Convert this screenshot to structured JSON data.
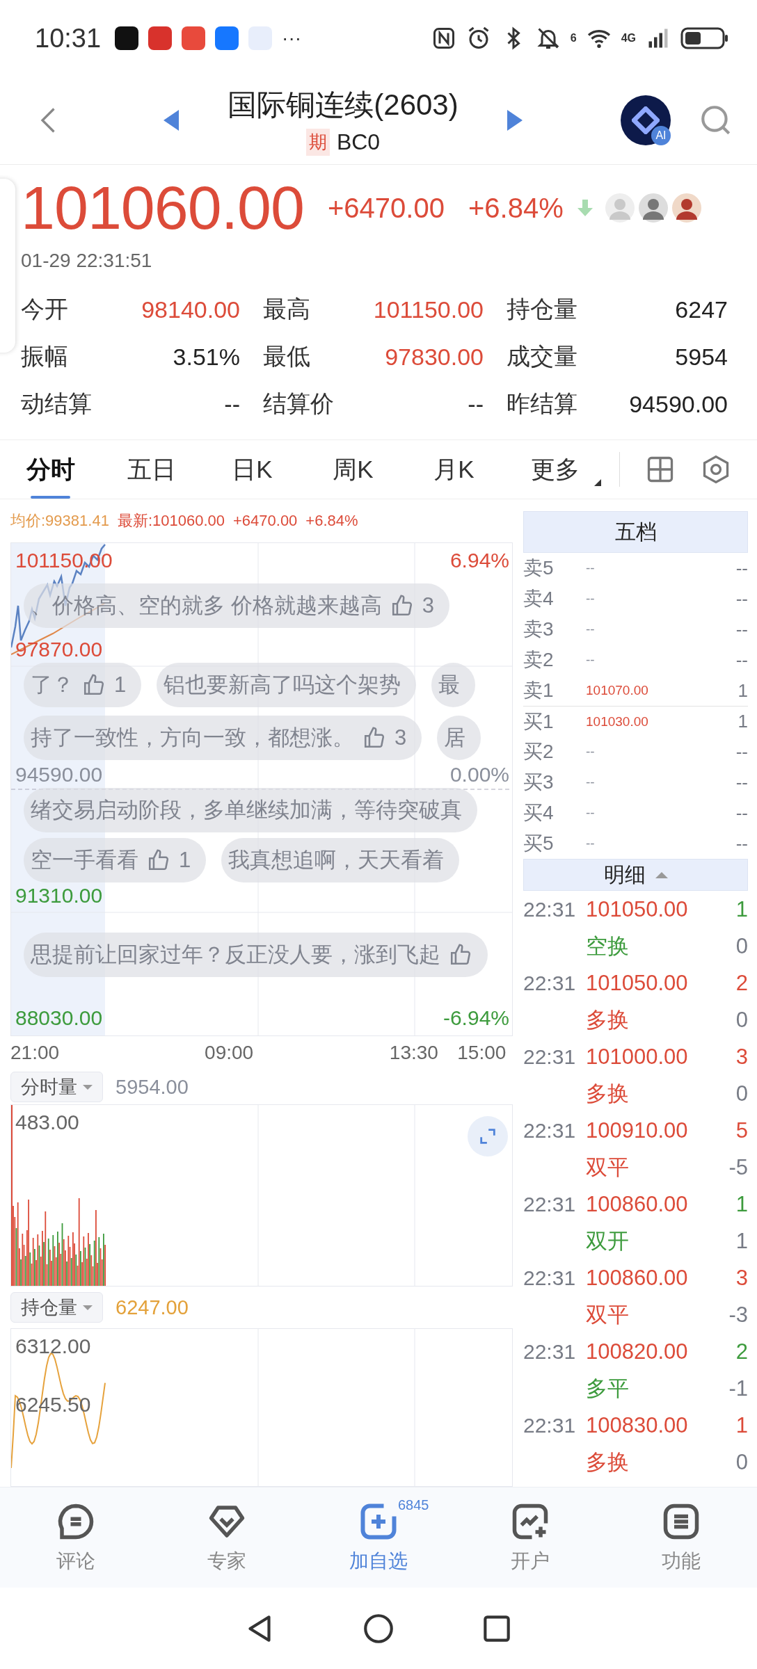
{
  "status_bar": {
    "time": "10:31",
    "more": "···",
    "wifi_badge": "6",
    "network": "4G"
  },
  "header": {
    "title": "国际铜连续(2603)",
    "tag": "期",
    "code": "BC0",
    "ai_badge": "AI"
  },
  "quote": {
    "price": "101060.00",
    "change": "+6470.00",
    "change_pct": "+6.84%",
    "timestamp": "01-29 22:31:51"
  },
  "stats": [
    {
      "label": "今开",
      "value": "98140.00",
      "color": "#dc4b39"
    },
    {
      "label": "最高",
      "value": "101150.00",
      "color": "#dc4b39"
    },
    {
      "label": "持仓量",
      "value": "6247",
      "color": "#222222"
    },
    {
      "label": "振幅",
      "value": "3.51%",
      "color": "#222222"
    },
    {
      "label": "最低",
      "value": "97830.00",
      "color": "#dc4b39"
    },
    {
      "label": "成交量",
      "value": "5954",
      "color": "#222222"
    },
    {
      "label": "动结算",
      "value": "--",
      "color": "#222222"
    },
    {
      "label": "结算价",
      "value": "--",
      "color": "#222222"
    },
    {
      "label": "昨结算",
      "value": "94590.00",
      "color": "#222222"
    }
  ],
  "tabs": [
    {
      "label": "分时",
      "selected": true,
      "kind": "plain"
    },
    {
      "label": "五日",
      "selected": false,
      "kind": "plain"
    },
    {
      "label": "日K",
      "selected": false,
      "kind": "plain"
    },
    {
      "label": "周K",
      "selected": false,
      "kind": "plain"
    },
    {
      "label": "月K",
      "selected": false,
      "kind": "plain"
    },
    {
      "label": "更多",
      "selected": false,
      "kind": "menu"
    }
  ],
  "chart": {
    "avg": "均价:99381.41",
    "latest": "最新:101060.00",
    "change": "+6470.00",
    "change_pct": "+6.84%",
    "left_labels": [
      {
        "text": "101150.00",
        "color": "#dc4b39"
      },
      {
        "text": "97870.00",
        "color": "#dc4b39"
      },
      {
        "text": "94590.00",
        "color": "#8a8f9b"
      },
      {
        "text": "91310.00",
        "color": "#3d9b3d"
      },
      {
        "text": "88030.00",
        "color": "#3d9b3d"
      }
    ],
    "right_labels": [
      {
        "text": "6.94%",
        "color": "#dc4b39"
      },
      {
        "text": "0.00%",
        "color": "#8a8f9b"
      },
      {
        "text": "-6.94%",
        "color": "#3d9b3d"
      }
    ],
    "time_axis": [
      "21:00",
      "09:00",
      "13:30",
      "15:00"
    ],
    "comments": [
      [
        {
          "text": "、价格高、空的就多 价格就越来越高",
          "kind": "liked",
          "likes": "3"
        }
      ],
      [
        {
          "text": "了？",
          "kind": "liked",
          "likes": "1"
        },
        {
          "text": "铝也要新高了吗这个架势",
          "kind": "plain"
        },
        {
          "text": "最",
          "kind": "plain"
        }
      ],
      [
        {
          "text": "持了一致性，方向一致，都想涨。",
          "kind": "liked",
          "likes": "3"
        },
        {
          "text": "居",
          "kind": "plain"
        }
      ],
      [
        {
          "text": "绪交易启动阶段，多单继续加满，等待突破真",
          "kind": "plain"
        }
      ],
      [
        {
          "text": "空一手看看",
          "kind": "liked",
          "likes": "1"
        },
        {
          "text": "我真想追啊，天天看着",
          "kind": "plain"
        }
      ],
      [
        {
          "text": "思提前让回家过年？反正没人要，涨到飞起",
          "kind": "liked"
        }
      ]
    ]
  },
  "volume": {
    "selector": "分时量",
    "total": "5954.00",
    "max_label": "483.00"
  },
  "open_interest": {
    "selector": "持仓量",
    "total": "6247.00",
    "labels": [
      "6312.00",
      "6245.50"
    ]
  },
  "order_book": {
    "title": "五档",
    "levels": [
      {
        "label": "卖5",
        "price": "--",
        "volume": "--",
        "color": "#8a8f9b"
      },
      {
        "label": "卖4",
        "price": "--",
        "volume": "--",
        "color": "#8a8f9b"
      },
      {
        "label": "卖3",
        "price": "--",
        "volume": "--",
        "color": "#8a8f9b"
      },
      {
        "label": "卖2",
        "price": "--",
        "volume": "--",
        "color": "#8a8f9b"
      },
      {
        "label": "卖1",
        "price": "101070.00",
        "volume": "1",
        "color": "#dc4b39"
      },
      {
        "label": "买1",
        "price": "101030.00",
        "volume": "1",
        "color": "#dc4b39"
      },
      {
        "label": "买2",
        "price": "--",
        "volume": "--",
        "color": "#8a8f9b"
      },
      {
        "label": "买3",
        "price": "--",
        "volume": "--",
        "color": "#8a8f9b"
      },
      {
        "label": "买4",
        "price": "--",
        "volume": "--",
        "color": "#8a8f9b"
      },
      {
        "label": "买5",
        "price": "--",
        "volume": "--",
        "color": "#8a8f9b"
      }
    ]
  },
  "trades": {
    "title": "明细",
    "rows": [
      {
        "time": "22:31",
        "price": "101050.00",
        "volume": "1",
        "type": "空换",
        "oi_change": "0",
        "color": "#3d9b3d"
      },
      {
        "time": "22:31",
        "price": "101050.00",
        "volume": "2",
        "type": "多换",
        "oi_change": "0",
        "color": "#dc4b39"
      },
      {
        "time": "22:31",
        "price": "101000.00",
        "volume": "3",
        "type": "多换",
        "oi_change": "0",
        "color": "#dc4b39"
      },
      {
        "time": "22:31",
        "price": "100910.00",
        "volume": "5",
        "type": "双平",
        "oi_change": "-5",
        "color": "#dc4b39"
      },
      {
        "time": "22:31",
        "price": "100860.00",
        "volume": "1",
        "type": "双开",
        "oi_change": "1",
        "color": "#3d9b3d"
      },
      {
        "time": "22:31",
        "price": "100860.00",
        "volume": "3",
        "type": "双平",
        "oi_change": "-3",
        "color": "#dc4b39"
      },
      {
        "time": "22:31",
        "price": "100820.00",
        "volume": "2",
        "type": "多平",
        "oi_change": "-1",
        "color": "#3d9b3d"
      },
      {
        "time": "22:31",
        "price": "100830.00",
        "volume": "1",
        "type": "多换",
        "oi_change": "0",
        "color": "#dc4b39"
      }
    ]
  },
  "bottom_nav": [
    {
      "label": "评论",
      "selected": false
    },
    {
      "label": "专家",
      "selected": false
    },
    {
      "label": "加自选",
      "selected": true,
      "badge": "6845"
    },
    {
      "label": "开户",
      "selected": false
    },
    {
      "label": "功能",
      "selected": false
    }
  ]
}
